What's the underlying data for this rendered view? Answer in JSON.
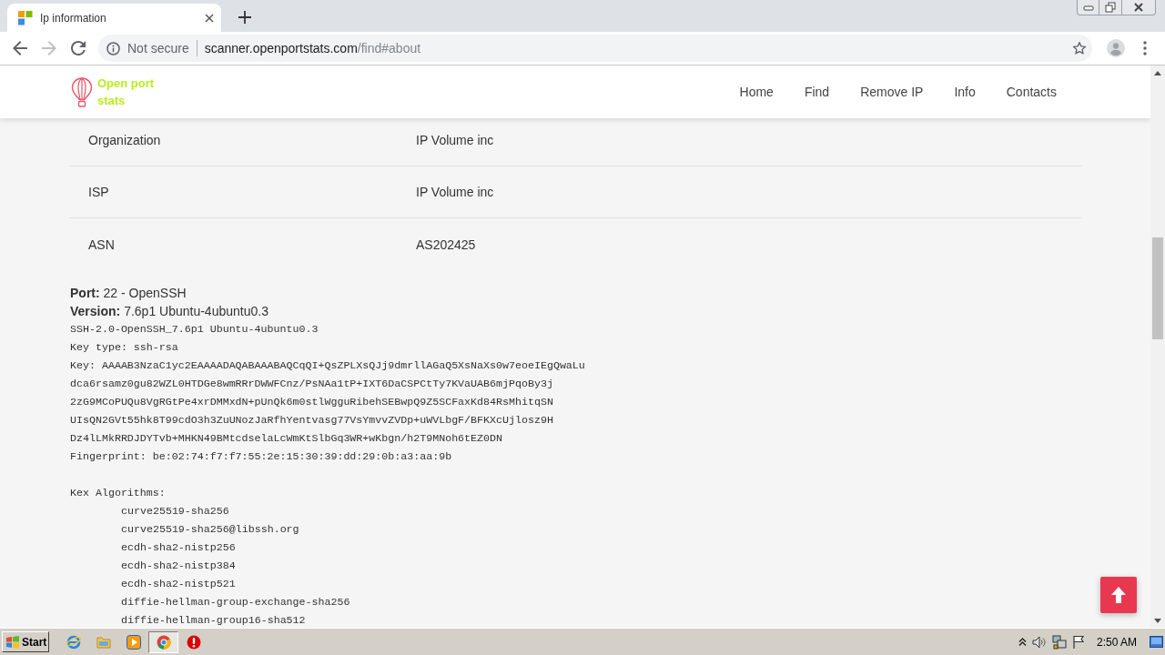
{
  "browser": {
    "tabs": [
      {
        "title": "Ip information",
        "selected": true
      }
    ],
    "forward_disabled": true,
    "address_bar": {
      "security_label": "Not secure",
      "host": "scanner.openportstats.com",
      "path": "/find#about"
    }
  },
  "site_header": {
    "logo_lines": [
      "Open port",
      "stats"
    ],
    "nav": [
      "Home",
      "Find",
      "Remove IP",
      "Info",
      "Contacts"
    ]
  },
  "info_table": {
    "rows": [
      {
        "label": "Organization",
        "value": "IP Volume inc"
      },
      {
        "label": "ISP",
        "value": "IP Volume inc"
      },
      {
        "label": "ASN",
        "value": "AS202425"
      }
    ]
  },
  "port_details": {
    "summary": [
      "**Port:** 22 - OpenSSH",
      "**Version:** 7.6p1 Ubuntu-4ubuntu0.3"
    ],
    "raw_lines": [
      "SSH-2.0-OpenSSH_7.6p1 Ubuntu-4ubuntu0.3",
      "Key type: ssh-rsa",
      "Key: AAAAB3NzaC1yc2EAAAADAQABAAABAQCqQI+QsZPLXsQJj9dmrllAGaQ5XsNaXs0w7eoeIEgQwaLu",
      "dca6rsamz0gu82WZL0HTDGe8wmRRrDWWFCnz/PsNAa1tP+IXT6DaCSPCtTy7KVaUAB6mjPqoBy3j",
      "2zG9MCoPUQu8VgRGtPe4xrDMMxdN+pUnQk6m0stlWgguRibehSEBwpQ9Z5SCFaxKd84RsMhitqSN",
      "UIsQN2GVt55hk8T99cdO3h3ZuUNozJaRfhYentvasg77VsYmvvZVDp+uWVLbgF/BFKXcUjlosz9H",
      "Dz4lLMkRRDJDYTvb+MHKN49BMtcdselaLcWmKtSlbGq3WR+wKbgn/h2T9MNoh6tEZ0DN",
      "Fingerprint: be:02:74:f7:f7:55:2e:15:30:39:dd:29:0b:a3:aa:9b"
    ],
    "kex_heading": "Kex Algorithms:",
    "kex_algorithms": [
      "curve25519-sha256",
      "curve25519-sha256@libssh.org",
      "ecdh-sha2-nistp256",
      "ecdh-sha2-nistp384",
      "ecdh-sha2-nistp521",
      "diffie-hellman-group-exchange-sha256",
      "diffie-hellman-group16-sha512"
    ]
  },
  "taskbar": {
    "start_label": "Start",
    "apps": [
      {
        "kind": "globe",
        "selected": false
      },
      {
        "kind": "folder",
        "selected": false
      },
      {
        "kind": "player",
        "selected": false
      },
      {
        "kind": "browser",
        "selected": true
      },
      {
        "kind": "alert",
        "selected": false
      }
    ],
    "clock": "2:50 AM"
  }
}
